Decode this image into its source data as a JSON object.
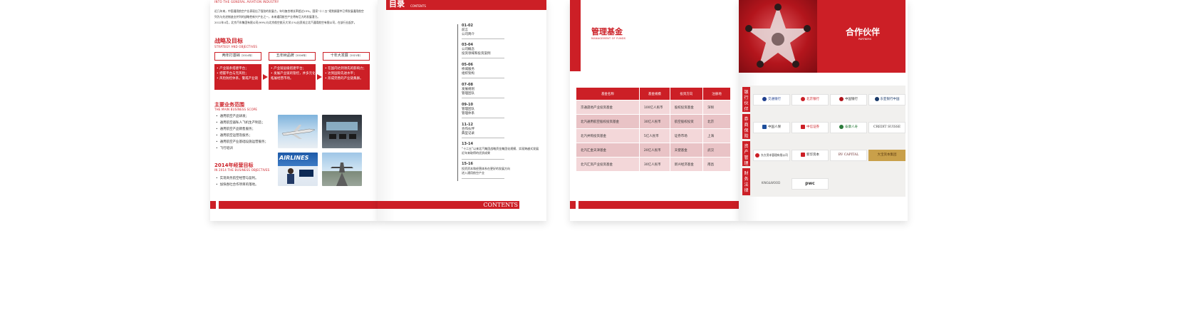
{
  "left_page": {
    "header_en": "INTO THE GENERAL AVIATION INDUSTRY",
    "intro_line1": "近几年来，中国通用航空产业表现出了强劲的发展力，年均复合增长率超过15%，国家“十二五”规划纲要中已将发展通用航空",
    "intro_line2": "列为与先进制造业并列的战略性新兴产业之一，未来通用航空产业将有巨大的发展潜力。",
    "intro_line3": "2012年4月，北京汽车集团有限公司(99%)与北京航空航天大学(1%)出资成立北汽通用航空有限公司，在该行业起步。",
    "strategy_title": "战略及目标",
    "strategy_sub": "STRATEGY AND OBJECTIVES",
    "phases": [
      {
        "title": "两年打基础",
        "year": "（2014年）",
        "lines": [
          "• 产业链条搭建平台；",
          "• 把握平台与无风险；",
          "• 风险防控体系，警戒产业链"
        ]
      },
      {
        "title": "五年树品牌",
        "year": "（2016年）",
        "lines": [
          "• 产业链层级搭建平台；",
          "• 发展产业链的管控，并多元化",
          "  拓展经营市场。"
        ]
      },
      {
        "title": "十年大发展",
        "year": "（2021年）",
        "lines": [
          "• 在国内达到领先的影响力；",
          "• 达到国际先进水平；",
          "• 形成完善的产业链集群。"
        ]
      }
    ],
    "scope_title": "主要业务范围",
    "scope_sub": "THE MAIN BUSINESS SCOPE",
    "scope_items": [
      "通用航空产品研发；",
      "通用航空器私人飞机生产制造；",
      "通用航空产品销售服务；",
      "通用航空运营及服务；",
      "通用航空产业基础设施运营服务；",
      "飞行培训"
    ],
    "goal_title": "2014年经营目标",
    "goal_sub": "IN 2014 THE BUSINESS OBJECTIVES",
    "goal_items": [
      "实现商务航空经营与盈利。",
      "加快吞吐合作项目的落地。"
    ],
    "photo_text": "AIRLINES"
  },
  "toc_page": {
    "title": "目录",
    "title_en": "CONTENTS",
    "entries": [
      {
        "num": "01-02",
        "lines": [
          "前言",
          "公司简介"
        ]
      },
      {
        "num": "03-04",
        "lines": [
          "公司概念",
          "投资领域和投资案例"
        ]
      },
      {
        "num": "05-06",
        "lines": [
          "桥城服务",
          "组织架构"
        ]
      },
      {
        "num": "07-08",
        "lines": [
          "发展规划",
          "管理团队"
        ]
      },
      {
        "num": "09-10",
        "lines": [
          "管理团队",
          "管理体系"
        ]
      },
      {
        "num": "11-12",
        "lines": [
          "合作伙伴",
          "典型记录"
        ]
      },
      {
        "num": "13-14",
        "lines": [
          "“十二五”以来北汽集团战略资金集团化规模、实现跨越式发展",
          "近年来取得的优质成果"
        ]
      },
      {
        "num": "15-16",
        "lines": [
          "投资资本和经营体系在更好的发展方向",
          "进入通用航空产业"
        ]
      }
    ],
    "footer": "CONTENTS"
  },
  "fund_page": {
    "title": "管理基金",
    "title_en": "MANAGEMENT OF FUNDS",
    "columns": [
      "基金名称",
      "基金规模",
      "投资方向",
      "注册地"
    ],
    "rows": [
      [
        "京通晟地产业投资基金",
        "100亿人民币",
        "股权投资基金",
        "深圳"
      ],
      [
        "北汽通用航空股权投资基金",
        "30亿人民币",
        "航空股权投资",
        "北京"
      ],
      [
        "北汽并购投资基金",
        "5亿人民币",
        "证券市场",
        "上海"
      ],
      [
        "北汽汇金天津基金",
        "20亿人民币",
        "天使基金",
        "武汉"
      ],
      [
        "北汽汇资产业投资基金",
        "30亿人民币",
        "新兴经济基金",
        "南昌"
      ]
    ]
  },
  "partner_page": {
    "title": "合作伙伴",
    "title_en": "PARTNERS",
    "categories": [
      {
        "label": "银行伙伴",
        "logos": [
          "交通银行",
          "北京银行",
          "中国银行",
          "东亚银行中国"
        ]
      },
      {
        "label": "券商保险",
        "logos": [
          "中国人保",
          "中信证券",
          "泰康人寿",
          "CREDIT SUISSE"
        ]
      },
      {
        "label": "资产管理",
        "logos": [
          "东方资本管理有限公司",
          "新华资本",
          "BV CAPITAL",
          "大宝资本集团"
        ]
      },
      {
        "label": "财务法律",
        "logos": [
          "KING&WOOD",
          "pwc"
        ]
      }
    ]
  }
}
